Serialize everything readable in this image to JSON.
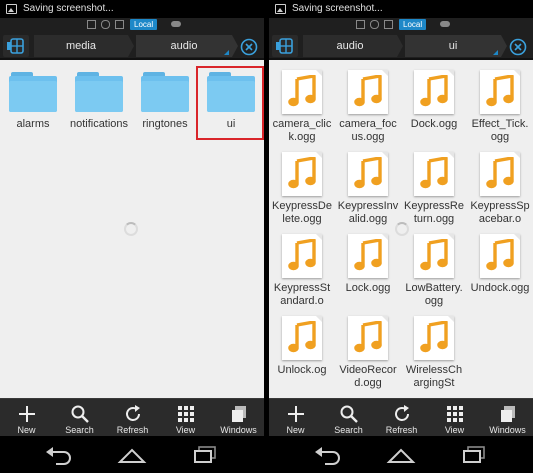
{
  "colors": {
    "accent": "#1e88c8",
    "folder": "#6dc0ee",
    "note": "#f0a020",
    "selection": "#d9252a",
    "toolbar": "#2b2b2b"
  },
  "left": {
    "status": {
      "title": "Saving screenshot..."
    },
    "strip": {
      "local_badge": "Local"
    },
    "breadcrumb": [
      "media",
      "audio"
    ],
    "items": [
      {
        "name": "alarms",
        "icon": "folder-icon"
      },
      {
        "name": "notifications",
        "icon": "folder-icon"
      },
      {
        "name": "ringtones",
        "icon": "folder-icon"
      },
      {
        "name": "ui",
        "icon": "folder-icon",
        "selected": true
      }
    ],
    "toolbar": [
      "New",
      "Search",
      "Refresh",
      "View",
      "Windows"
    ]
  },
  "right": {
    "status": {
      "title": "Saving screenshot..."
    },
    "strip": {
      "local_badge": "Local"
    },
    "breadcrumb": [
      "audio",
      "ui"
    ],
    "items": [
      {
        "name": "camera_click.ogg",
        "icon": "music-note-icon"
      },
      {
        "name": "camera_focus.ogg",
        "icon": "music-note-icon"
      },
      {
        "name": "Dock.ogg",
        "icon": "music-note-icon"
      },
      {
        "name": "Effect_Tick.ogg",
        "icon": "music-note-icon"
      },
      {
        "name": "KeypressDelete.ogg",
        "icon": "music-note-icon"
      },
      {
        "name": "KeypressInvalid.ogg",
        "icon": "music-note-icon"
      },
      {
        "name": "KeypressReturn.ogg",
        "icon": "music-note-icon"
      },
      {
        "name": "KeypressSpacebar.o",
        "icon": "music-note-icon"
      },
      {
        "name": "KeypressStandard.o",
        "icon": "music-note-icon"
      },
      {
        "name": "Lock.ogg",
        "icon": "music-note-icon"
      },
      {
        "name": "LowBattery.ogg",
        "icon": "music-note-icon"
      },
      {
        "name": "Undock.ogg",
        "icon": "music-note-icon"
      },
      {
        "name": "Unlock.og",
        "icon": "music-note-icon"
      },
      {
        "name": "VideoRecord.ogg",
        "icon": "music-note-icon"
      },
      {
        "name": "WirelessChargingSt",
        "icon": "music-note-icon"
      }
    ],
    "toolbar": [
      "New",
      "Search",
      "Refresh",
      "View",
      "Windows"
    ]
  }
}
